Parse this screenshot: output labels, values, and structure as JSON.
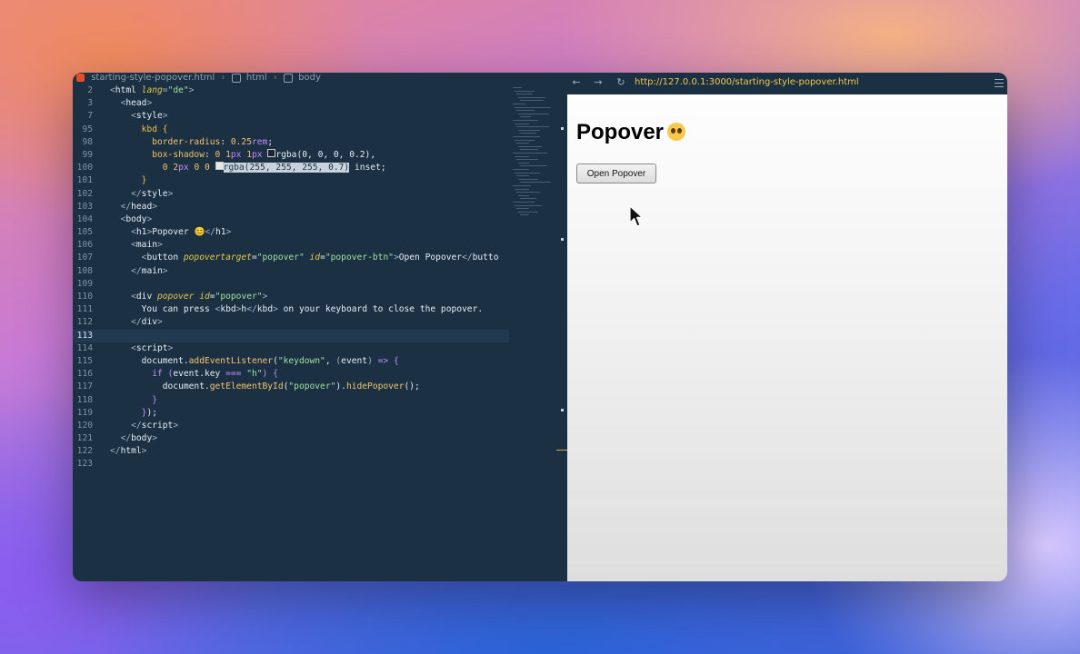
{
  "editor": {
    "breadcrumb": {
      "file": "starting-style-popover.html",
      "crumb1": "html",
      "crumb2": "body"
    },
    "lines": [
      {
        "n": "2",
        "html": "<span class='p'>&lt;</span><span class='t'>html</span> <span class='a'>lang</span><span class='p'>=</span><span class='s'>\"de\"</span><span class='p'>&gt;</span>"
      },
      {
        "n": "3",
        "html": "  <span class='p'>&lt;</span>head<span class='p'>&gt;</span>"
      },
      {
        "n": "7",
        "html": "    <span class='p'>&lt;</span>style<span class='p'>&gt;</span>"
      },
      {
        "n": "95",
        "html": "      <span class='k'>kbd {</span>"
      },
      {
        "n": "98",
        "html": "        <span class='f'>border-radius</span>: <span class='n'>0.25</span><span class='u'>rem</span>;"
      },
      {
        "n": "99",
        "html": "        <span class='f'>box-shadow</span>: <span class='n'>0</span> <span class='n'>1</span><span class='u'>px</span> <span class='n'>1</span><span class='u'>px</span> <span class='sw' style='background:rgba(0,0,0,.2)'></span>rgba(0, 0, 0, 0.2),"
      },
      {
        "n": "100",
        "html": "          <span class='n'>0</span> <span class='n'>2</span><span class='u'>px</span> <span class='n'>0</span> <span class='n'>0</span> <span class='sw' style='background:#e8e8e8'></span><span class='sel'>rgba(255, 255, 255, 0.7)</span> inset;"
      },
      {
        "n": "101",
        "html": "      <span class='k'>}</span>"
      },
      {
        "n": "102",
        "html": "    <span class='p'>&lt;/</span>style<span class='p'>&gt;</span>"
      },
      {
        "n": "103",
        "html": "  <span class='p'>&lt;/</span>head<span class='p'>&gt;</span>"
      },
      {
        "n": "104",
        "html": "  <span class='p'>&lt;</span>body<span class='p'>&gt;</span>"
      },
      {
        "n": "105",
        "html": "    <span class='p'>&lt;</span>h1<span class='p'>&gt;</span>Popover 😊<span class='p'>&lt;/</span>h1<span class='p'>&gt;</span>"
      },
      {
        "n": "106",
        "html": "    <span class='p'>&lt;</span>main<span class='p'>&gt;</span>"
      },
      {
        "n": "107",
        "html": "      <span class='p'>&lt;</span>button <span class='a'>popovertarget</span>=<span class='s'>\"popover\"</span> <span class='a'>id</span>=<span class='s'>\"popover-btn\"</span><span class='p'>&gt;</span>Open Popover<span class='p'>&lt;/</span>butto"
      },
      {
        "n": "108",
        "html": "    <span class='p'>&lt;/</span>main<span class='p'>&gt;</span>"
      },
      {
        "n": "109",
        "html": ""
      },
      {
        "n": "110",
        "html": "    <span class='p'>&lt;</span>div <span class='a'>popover</span> <span class='a'>id</span>=<span class='s'>\"popover\"</span><span class='p'>&gt;</span>"
      },
      {
        "n": "111",
        "html": "      You can press <span class='p'>&lt;</span>kbd<span class='p'>&gt;</span>h<span class='p'>&lt;/</span>kbd<span class='p'>&gt;</span> on your keyboard to close the popover."
      },
      {
        "n": "112",
        "html": "    <span class='p'>&lt;/</span>div<span class='p'>&gt;</span>"
      },
      {
        "n": "113",
        "html": "",
        "current": true
      },
      {
        "n": "114",
        "html": "    <span class='p'>&lt;</span>script<span class='p'>&gt;</span>"
      },
      {
        "n": "115",
        "html": "      document.<span class='f'>addEventListener</span>(<span class='s'>\"keydown\"</span>, <span class='p'>(</span>event<span class='p'>)</span> <span class='u'>=&gt;</span> <span class='u'>{</span>"
      },
      {
        "n": "116",
        "html": "        <span class='u'>if</span> <span class='u'>(</span>event.key <span class='u'>===</span> <span class='s'>\"h\"</span><span class='u'>)</span> <span class='u'>{</span>"
      },
      {
        "n": "117",
        "html": "          document.<span class='f'>getElementById</span>(<span class='s'>\"popover\"</span>).<span class='f'>hidePopover</span>();"
      },
      {
        "n": "118",
        "html": "        <span class='u'>}</span>"
      },
      {
        "n": "119",
        "html": "      <span class='u'>}</span>);"
      },
      {
        "n": "120",
        "html": "    <span class='p'>&lt;/</span>script<span class='p'>&gt;</span>"
      },
      {
        "n": "121",
        "html": "  <span class='p'>&lt;/</span>body<span class='p'>&gt;</span>"
      },
      {
        "n": "122",
        "html": "<span class='p'>&lt;/</span>html<span class='p'>&gt;</span>"
      },
      {
        "n": "123",
        "html": ""
      }
    ]
  },
  "browser": {
    "url": "http://127.0.0.1:3000/starting-style-popover.html",
    "back_icon": "←",
    "forward_icon": "→",
    "reload_icon": "↻",
    "page": {
      "heading": "Popover",
      "button_label": "Open Popover"
    }
  },
  "colors": {
    "editor_bg": "#1b3043",
    "url_color": "#f2c94c",
    "selection_bg": "#c7d2dc"
  }
}
